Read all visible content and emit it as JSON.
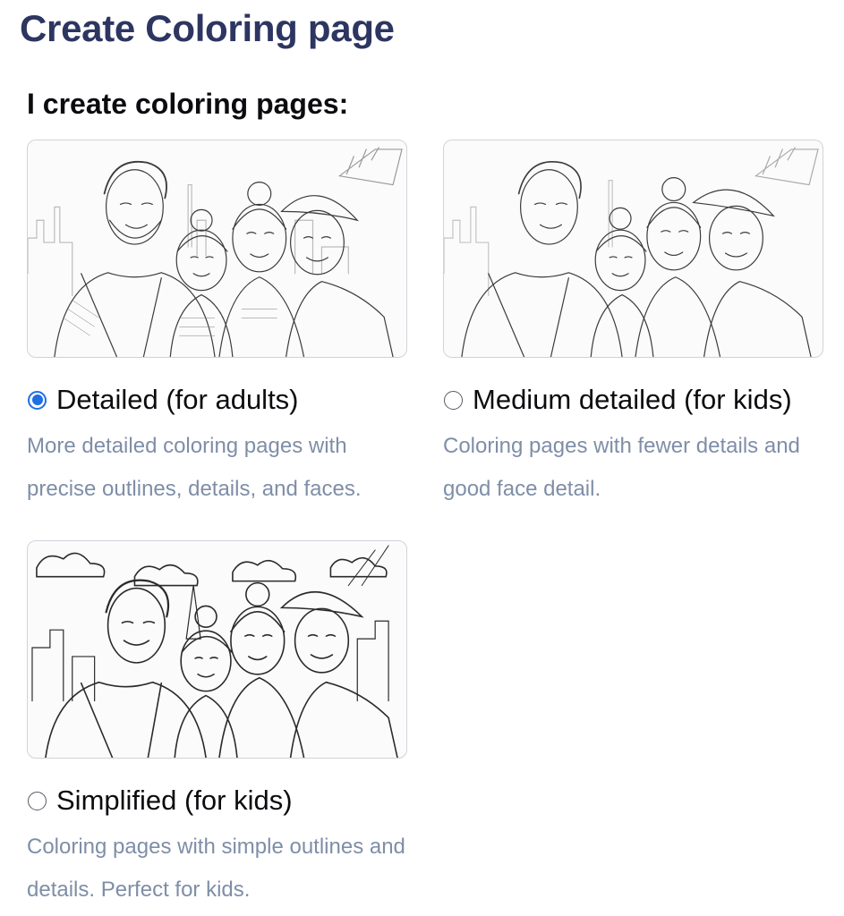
{
  "page": {
    "title": "Create Coloring page",
    "section_heading": "I create coloring pages:"
  },
  "options": [
    {
      "label": "Detailed (for adults)",
      "description": "More detailed coloring pages with precise outlines, details, and faces.",
      "selected": true,
      "image_alt": "family-portrait-detailed-line-art"
    },
    {
      "label": "Medium detailed (for kids)",
      "description": "Coloring pages with fewer details and good face detail.",
      "selected": false,
      "image_alt": "family-portrait-medium-line-art"
    },
    {
      "label": "Simplified (for kids)",
      "description": "Coloring pages with simple outlines and details. Perfect for kids.",
      "selected": false,
      "image_alt": "family-portrait-simplified-line-art"
    }
  ],
  "colors": {
    "title": "#2d3561",
    "heading": "#0c0c10",
    "description": "#7f8ea7",
    "radio_accent": "#1f6fe6",
    "card_border": "#cfd3da"
  }
}
